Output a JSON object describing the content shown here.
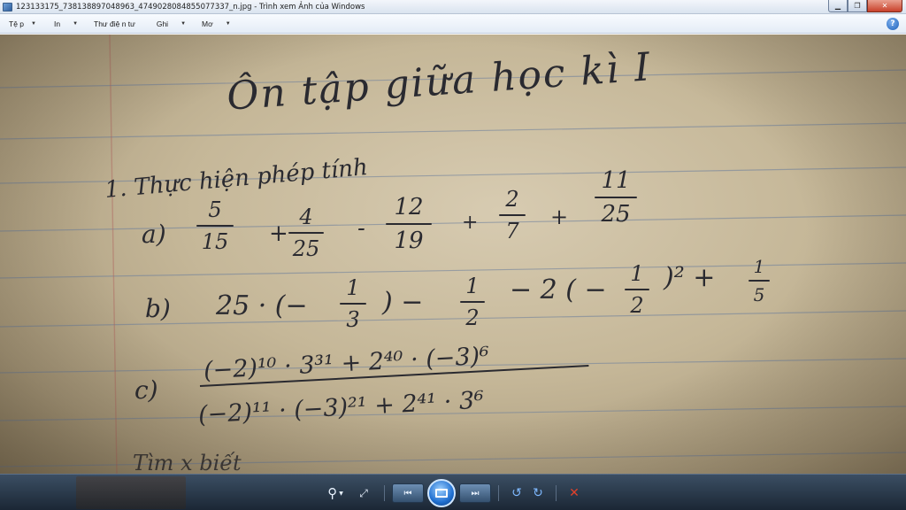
{
  "window": {
    "title": "123133175_738138897048963_4749028084855077337_n.jpg - Trình xem Ảnh của Windows",
    "minimize_glyph": "▁",
    "restore_glyph": "❐",
    "close_glyph": "✕"
  },
  "menu": {
    "items": [
      {
        "label": "Tệ p"
      },
      {
        "label": "In"
      },
      {
        "label": "Thư điệ n tư"
      },
      {
        "label": "Ghi"
      },
      {
        "label": "Mơ"
      }
    ],
    "help_glyph": "?"
  },
  "photo": {
    "title_line": "Ôn tập giữa học kì I",
    "section": "1.  Thực hiện phép tính",
    "a": {
      "label": "a)",
      "f1": {
        "num": "5",
        "den": "15"
      },
      "op1": "+",
      "f2": {
        "num": "4",
        "den": "25"
      },
      "op2": "-",
      "f3": {
        "num": "12",
        "den": "19"
      },
      "op3": "+",
      "f4": {
        "num": "2",
        "den": "7"
      },
      "op4": "+",
      "f5": {
        "num": "11",
        "den": "25"
      }
    },
    "b": {
      "label": "b)",
      "lead": "25 · (−",
      "f1": {
        "num": "1",
        "den": "3"
      },
      "close1": ")  −",
      "f2": {
        "num": "1",
        "den": "2"
      },
      "mid": "− 2 ( −",
      "f3": {
        "num": "1",
        "den": "2"
      },
      "close2": ")² +",
      "f4": {
        "num": "1",
        "den": "5"
      }
    },
    "c": {
      "label": "c)",
      "numerator": "(−2)¹⁰ · 3³¹ + 2⁴⁰ · (−3)⁶",
      "denominator": "(−2)¹¹ · (−3)²¹ + 2⁴¹ · 3⁶"
    },
    "cut_text": "Tìm x biết"
  },
  "toolbar": {
    "zoom_glyph": "⚲",
    "fit_glyph": "⤢",
    "prev_glyph": "⏮",
    "next_glyph": "⏭",
    "rotate_ccw_glyph": "↺",
    "rotate_cw_glyph": "↻",
    "delete_glyph": "✕"
  },
  "colors": {
    "paper": "#c8ba9b",
    "ink": "#2a2a30",
    "toolbar_bg": "#24313f",
    "delete_red": "#e0412b"
  }
}
